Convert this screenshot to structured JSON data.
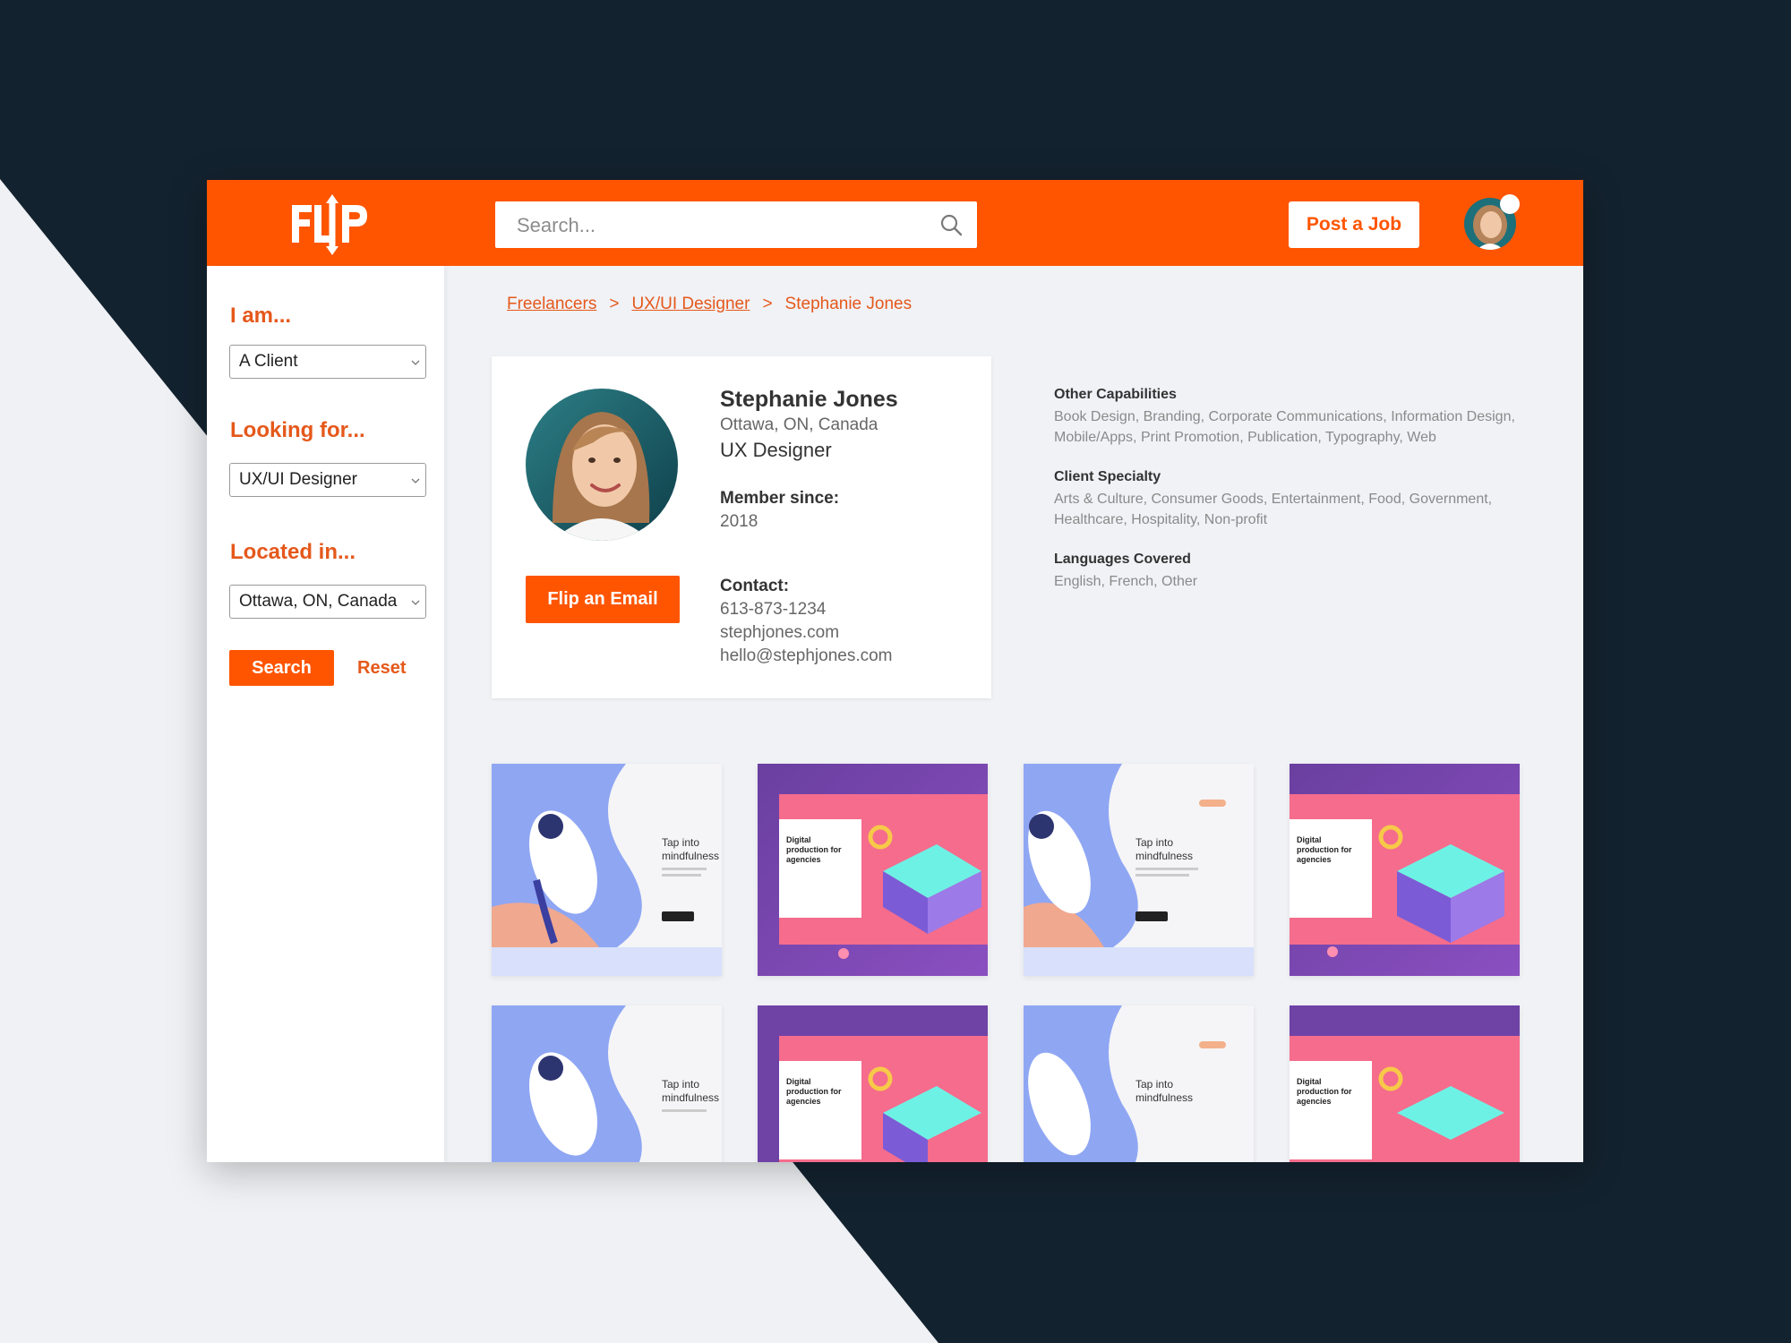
{
  "header": {
    "logo_text": "FLIP",
    "search_placeholder": "Search...",
    "post_job_label": "Post a Job"
  },
  "sidebar": {
    "i_am_label": "I am...",
    "i_am_value": "A Client",
    "looking_label": "Looking for...",
    "looking_value": "UX/UI Designer",
    "located_label": "Located in...",
    "located_value": "Ottawa, ON, Canada",
    "search_label": "Search",
    "reset_label": "Reset"
  },
  "breadcrumb": {
    "items": [
      "Freelancers",
      "UX/UI Designer",
      "Stephanie Jones"
    ],
    "separator": ">"
  },
  "profile": {
    "name": "Stephanie Jones",
    "location": "Ottawa, ON, Canada",
    "role": "UX Designer",
    "member_label": "Member since:",
    "member_value": "2018",
    "contact_label": "Contact:",
    "phone": "613-873-1234",
    "website": "stephjones.com",
    "email": "hello@stephjones.com",
    "flip_email_label": "Flip an Email"
  },
  "details": {
    "capabilities_title": "Other Capabilities",
    "capabilities_text": "Book Design, Branding, Corporate Communications, Information Design, Mobile/Apps, Print Promotion, Publication, Typography, Web",
    "specialty_title": "Client Specialty",
    "specialty_text": "Arts & Culture, Consumer Goods, Entertainment, Food, Government, Healthcare, Hospitality, Non-profit",
    "languages_title": "Languages Covered",
    "languages_text": "English, French, Other"
  },
  "gallery": {
    "mindful_title_1": "Tap into",
    "mindful_title_2": "mindfulness",
    "digital_title_1": "Digital",
    "digital_title_2": "production for",
    "digital_title_3": "agencies"
  },
  "colors": {
    "brand": "#ff5500",
    "brand_text": "#e5581b",
    "dark_bg": "#13222f",
    "light_bg": "#eff1f4"
  }
}
